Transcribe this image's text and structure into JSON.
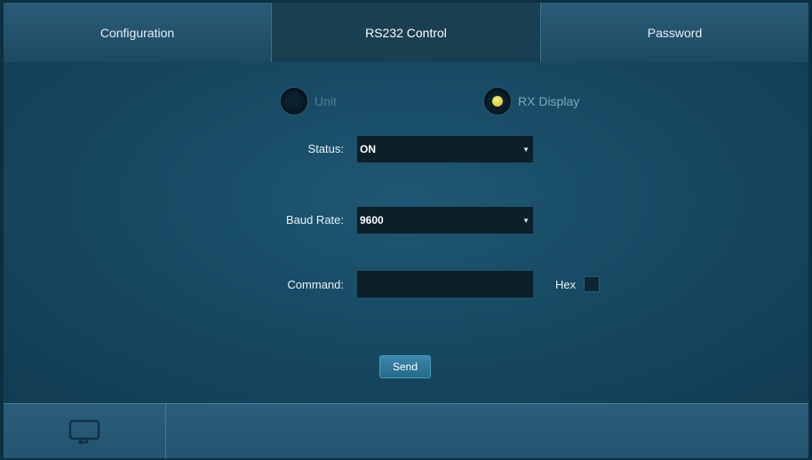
{
  "tabs": [
    {
      "label": "Configuration"
    },
    {
      "label": "RS232 Control"
    },
    {
      "label": "Password"
    }
  ],
  "target": {
    "unit_label": "Unit",
    "rx_display_label": "RX Display",
    "selected": "RX Display"
  },
  "form": {
    "status_label": "Status:",
    "status_value": "ON",
    "baud_rate_label": "Baud Rate:",
    "baud_rate_value": "9600",
    "command_label": "Command:",
    "command_value": "",
    "hex_label": "Hex",
    "hex_checked": false,
    "send_label": "Send"
  },
  "footer": {
    "icon": "refresh-icon"
  },
  "colors": {
    "selected_radio": "#e0d83a",
    "panel": "#174a63"
  }
}
